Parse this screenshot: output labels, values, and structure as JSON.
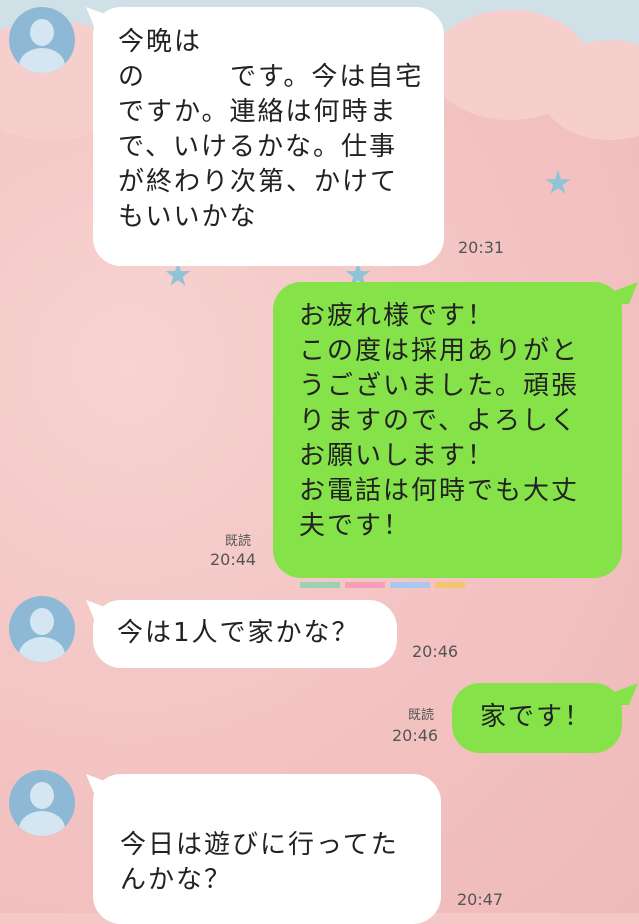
{
  "colors": {
    "incoming_bubble": "#ffffff",
    "outgoing_bubble": "#85e249",
    "background": "#f4c8c6"
  },
  "messages": [
    {
      "direction": "incoming",
      "text": "今晩は\nの　　　です。今は自宅\nですか。連絡は何時ま\nで、いけるかな。仕事\nが終わり次第、かけて\nもいいかな",
      "time": "20:31"
    },
    {
      "direction": "outgoing",
      "text": "お疲れ様です！\nこの度は採用ありがと\nうございました。頑張\nりますので、よろしく\nお願いします！\nお電話は何時でも大丈\n夫です！",
      "read": "既読",
      "time": "20:44"
    },
    {
      "direction": "incoming",
      "text": "今は1人で家かな？",
      "time": "20:46"
    },
    {
      "direction": "outgoing",
      "text": "家です！",
      "read": "既読",
      "time": "20:46"
    },
    {
      "direction": "incoming",
      "text": "今日は遊びに行ってた\nんかな？",
      "time": "20:47"
    }
  ]
}
